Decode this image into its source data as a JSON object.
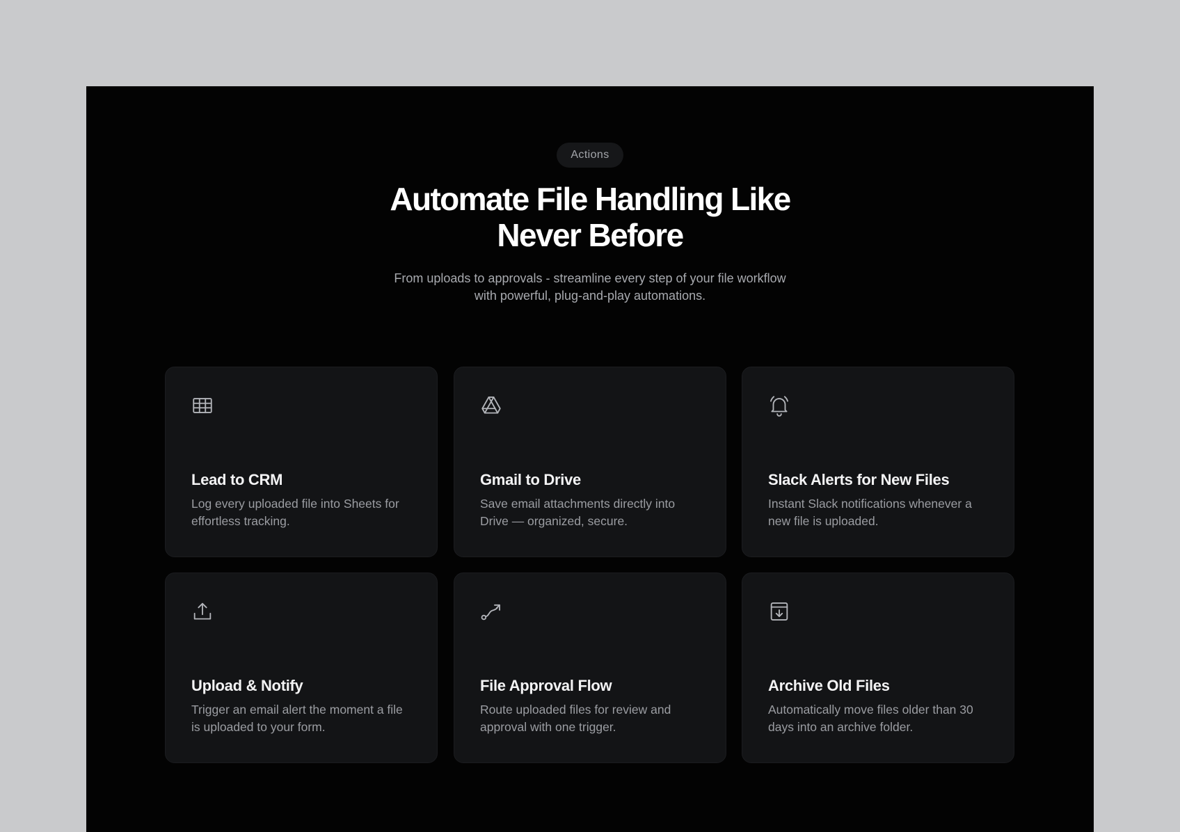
{
  "badge": "Actions",
  "title_line1": "Automate File Handling Like",
  "title_line2": "Never Before",
  "subtitle_line1": "From uploads to approvals - streamline every step of your file workflow",
  "subtitle_line2": "with powerful, plug-and-play automations.",
  "cards": [
    {
      "icon": "table-grid-icon",
      "title": "Lead to CRM",
      "desc": "Log every uploaded file into Sheets for effortless tracking."
    },
    {
      "icon": "drive-triangle-icon",
      "title": "Gmail to Drive",
      "desc": "Save email attachments directly into Drive — organized, secure."
    },
    {
      "icon": "alarm-bell-icon",
      "title": "Slack Alerts for New Files",
      "desc": "Instant Slack notifications whenever a new file is uploaded."
    },
    {
      "icon": "upload-icon",
      "title": "Upload & Notify",
      "desc": "Trigger an email alert the moment a file is uploaded to your form."
    },
    {
      "icon": "route-icon",
      "title": "File Approval Flow",
      "desc": "Route uploaded files for review and approval with one trigger."
    },
    {
      "icon": "archive-download-icon",
      "title": "Archive Old Files",
      "desc": "Automatically move files older than 30 days into an archive folder."
    }
  ]
}
